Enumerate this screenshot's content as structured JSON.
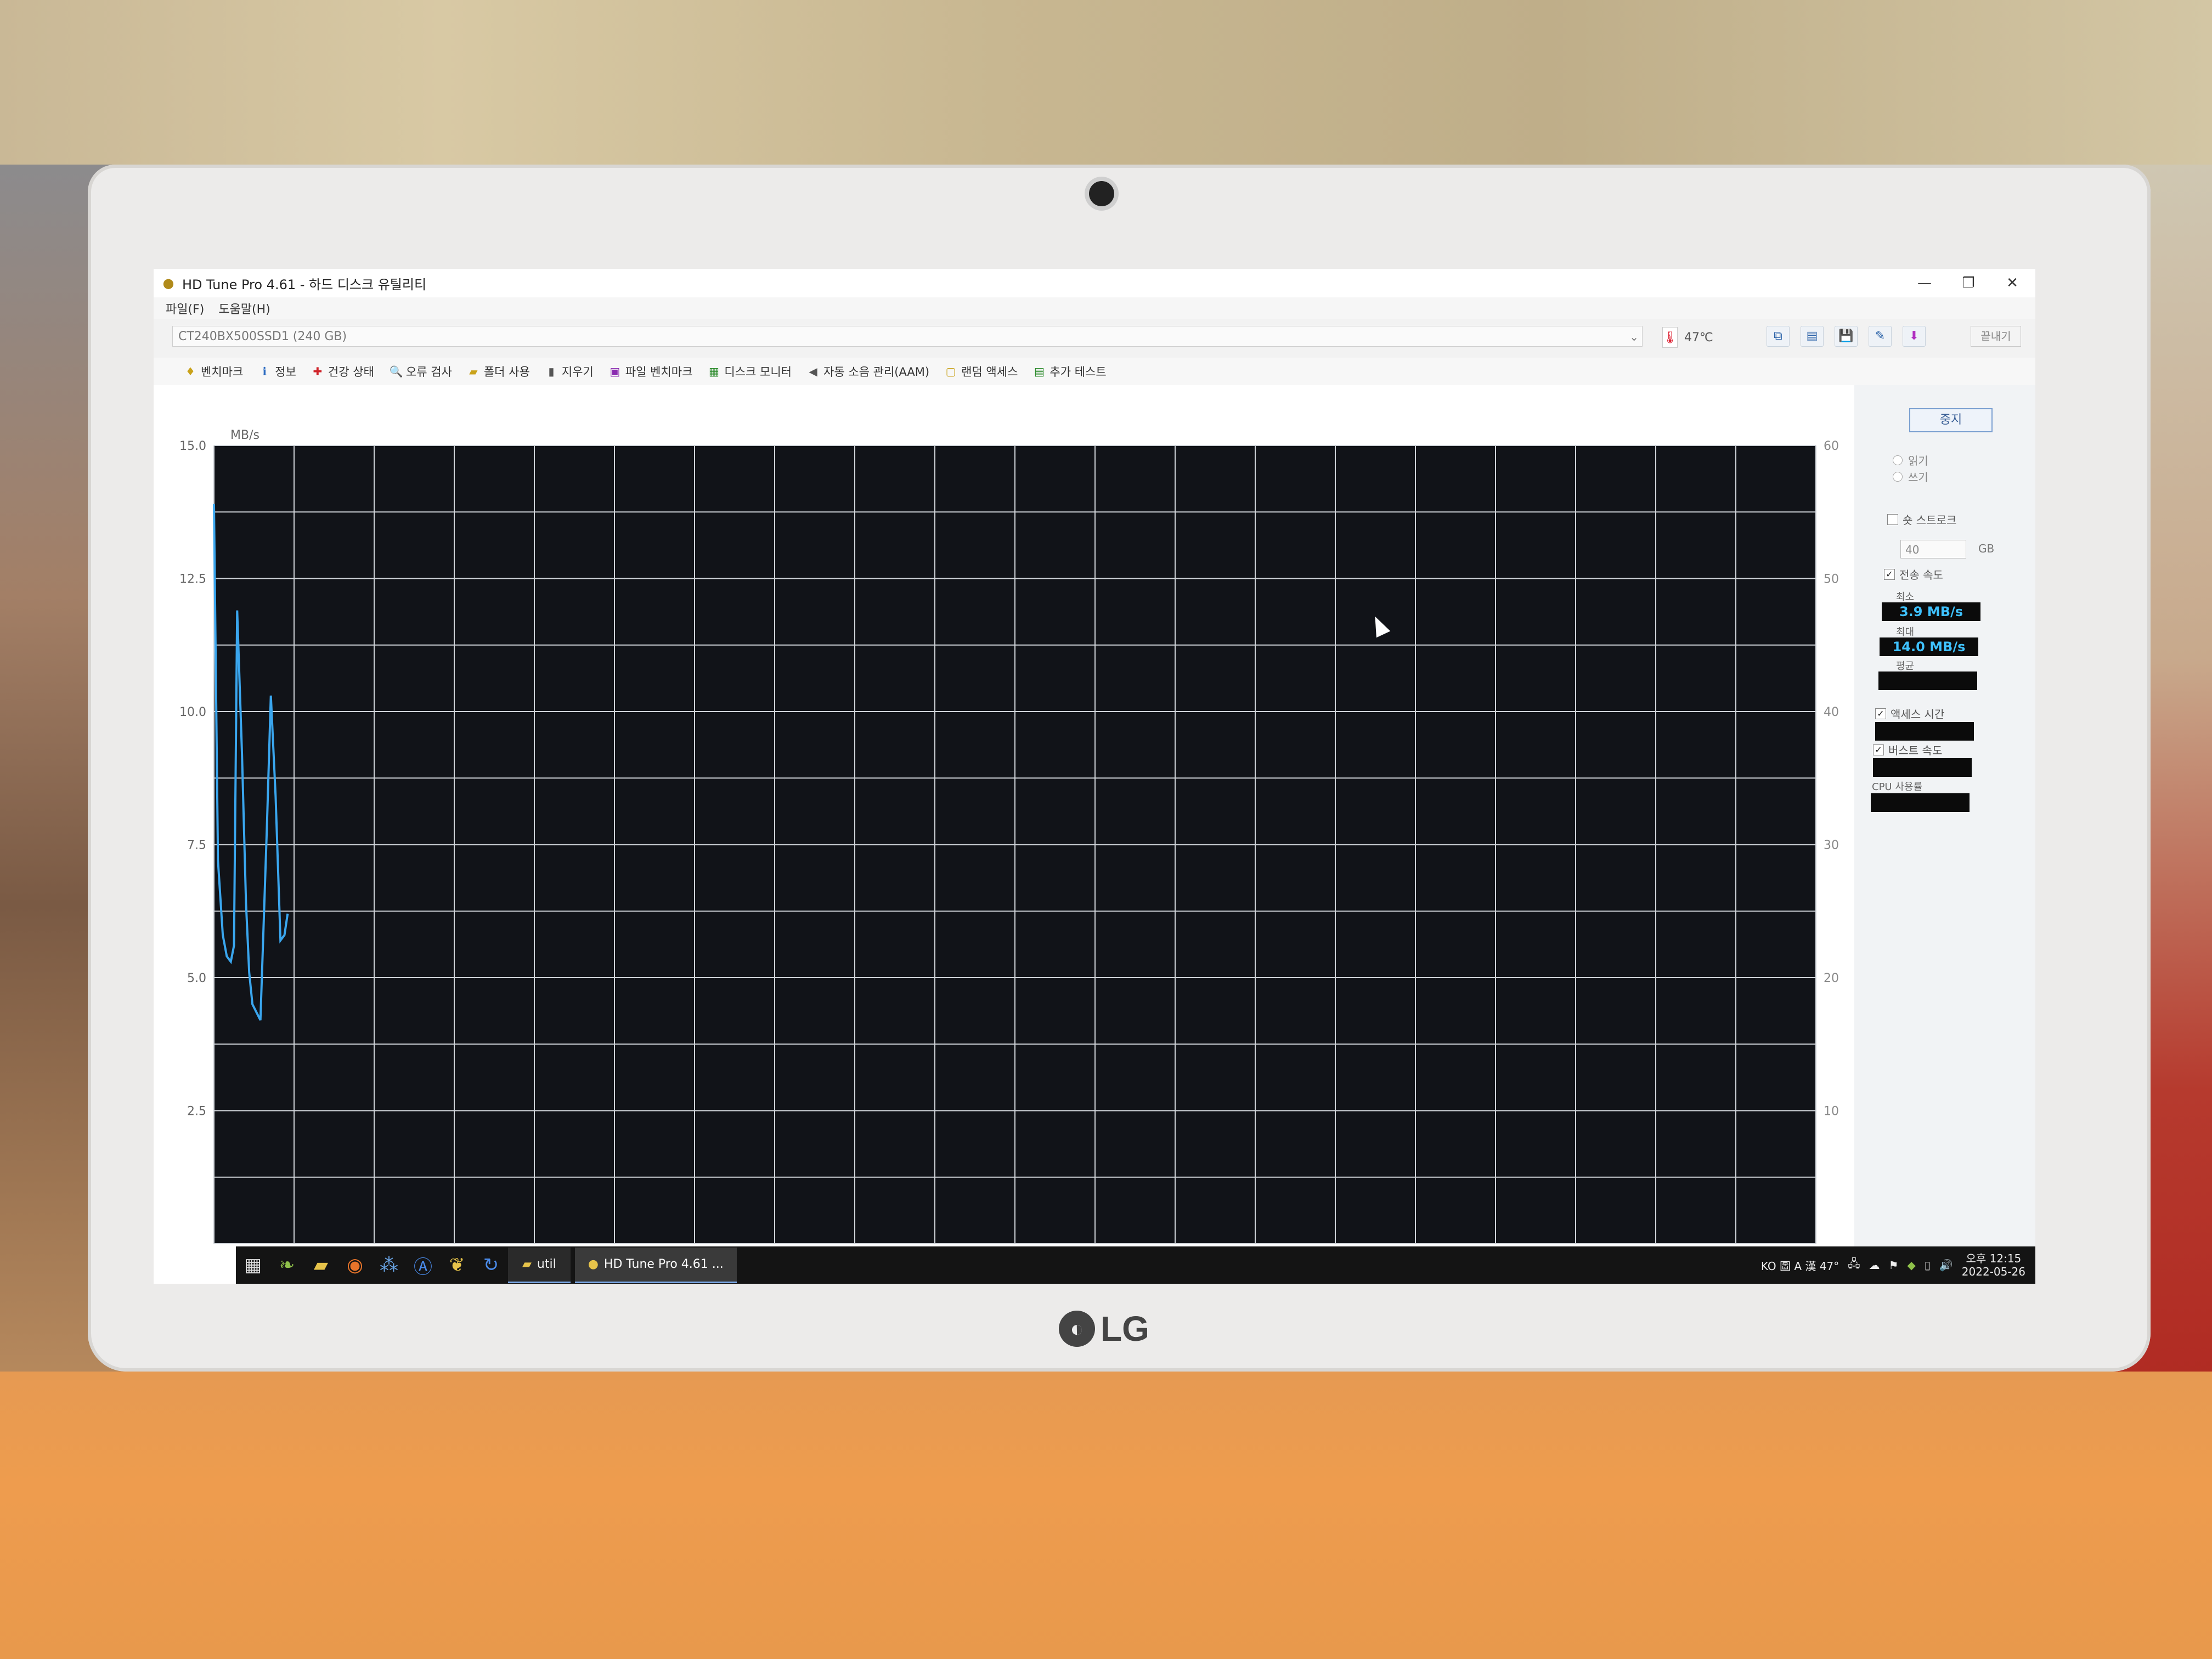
{
  "window": {
    "title": "HD Tune Pro 4.61 - 하드 디스크 유틸리티",
    "controls": [
      "—",
      "❐",
      "✕"
    ]
  },
  "menu": [
    "파일(F)",
    "도움말(H)"
  ],
  "drive": {
    "selected": "CT240BX500SSD1 (240 GB)",
    "temperature": "47℃",
    "exit_label": "끝내기"
  },
  "tabs": [
    "벤치마크",
    "정보",
    "건강 상태",
    "오류 검사",
    "폴더 사용",
    "지우기",
    "파일 벤치마크",
    "디스크 모니터",
    "자동 소음 관리(AAM)",
    "랜덤 액세스",
    "추가 테스트"
  ],
  "side": {
    "stop_label": "중지",
    "read_label": "읽기",
    "write_label": "쓰기",
    "short_stroke_label": "숏 스트로크",
    "short_stroke_value": "40",
    "short_stroke_unit": "GB",
    "transfer_rate_label": "전송 속도",
    "min_label": "최소",
    "min_value": "3.9 MB/s",
    "max_label": "최대",
    "max_value": "14.0 MB/s",
    "avg_label": "평균",
    "access_time_label": "액세스 시간",
    "burst_rate_label": "버스트 속도",
    "cpu_label": "CPU 사용률"
  },
  "chart_data": {
    "type": "line",
    "ylabel": "MB/s",
    "y_ticks": [
      "15.0",
      "12.5",
      "10.0",
      "7.5",
      "5.0",
      "2.5"
    ],
    "y2_ticks": [
      "60",
      "50",
      "40",
      "30",
      "20",
      "10"
    ],
    "ylim": [
      0,
      15
    ],
    "y2lim": [
      0,
      60
    ],
    "x_gridlines": 20,
    "series": [
      {
        "values": [
          [
            0.0,
            13.9
          ],
          [
            0.25,
            7.2
          ],
          [
            0.55,
            5.8
          ],
          [
            0.8,
            5.4
          ],
          [
            1.05,
            5.3
          ],
          [
            1.25,
            5.6
          ],
          [
            1.45,
            11.9
          ],
          [
            1.75,
            9.2
          ],
          [
            2.0,
            6.4
          ],
          [
            2.2,
            5.1
          ],
          [
            2.4,
            4.5
          ],
          [
            2.9,
            4.2
          ],
          [
            3.3,
            7.8
          ],
          [
            3.55,
            10.3
          ],
          [
            3.85,
            8.4
          ],
          [
            4.15,
            5.7
          ],
          [
            4.4,
            5.8
          ],
          [
            4.6,
            6.2
          ]
        ],
        "color": "#3aa6ee"
      }
    ]
  },
  "taskbar": {
    "util_label": "util",
    "app_label": "HD Tune Pro 4.61 ...",
    "tray_text": "KO 圖 A 漢 47°",
    "time": "오후 12:15",
    "date": "2022-05-26"
  },
  "monitor": {
    "brand": "LG"
  }
}
